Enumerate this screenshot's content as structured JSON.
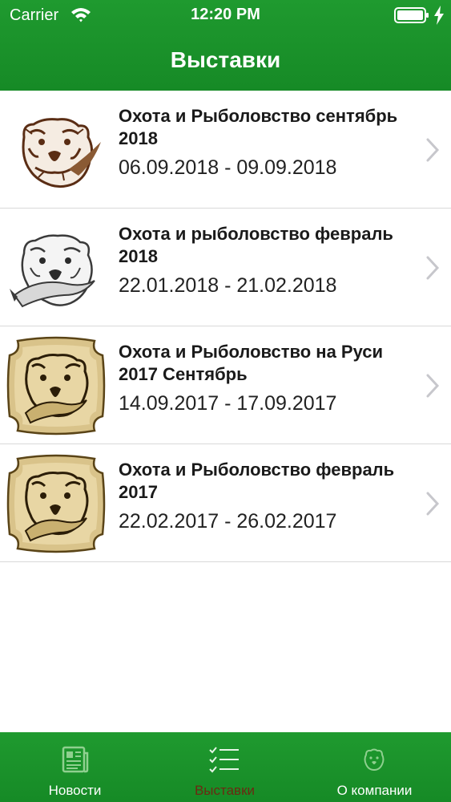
{
  "status_bar": {
    "carrier": "Carrier",
    "time": "12:20 PM"
  },
  "nav": {
    "title": "Выставки"
  },
  "exhibitions": [
    {
      "title": "Охота и Рыболовство сентябрь 2018",
      "dates": "06.09.2018 - 09.09.2018",
      "logo": "bear-brown-icon"
    },
    {
      "title": "Охота и рыболовство февраль 2018",
      "dates": "22.01.2018 - 21.02.2018",
      "logo": "bear-gray-icon"
    },
    {
      "title": "Охота и Рыболовство на Руси 2017 Сентябрь",
      "dates": "14.09.2017 - 17.09.2017",
      "logo": "bear-gold-plaque-icon"
    },
    {
      "title": "Охота и Рыболовство февраль 2017",
      "dates": "22.02.2017 - 26.02.2017",
      "logo": "bear-gold-plaque-icon"
    }
  ],
  "tabbar": {
    "tabs": [
      {
        "label": "Новости",
        "icon": "newspaper-icon",
        "active": false
      },
      {
        "label": "Выставки",
        "icon": "checklist-icon",
        "active": true
      },
      {
        "label": "О компании",
        "icon": "bear-emblem-icon",
        "active": false
      }
    ]
  },
  "colors": {
    "brand_green": "#1f9a2f",
    "active_tab_label": "#6b2a12",
    "plaque_gold": "#d9c38a"
  }
}
